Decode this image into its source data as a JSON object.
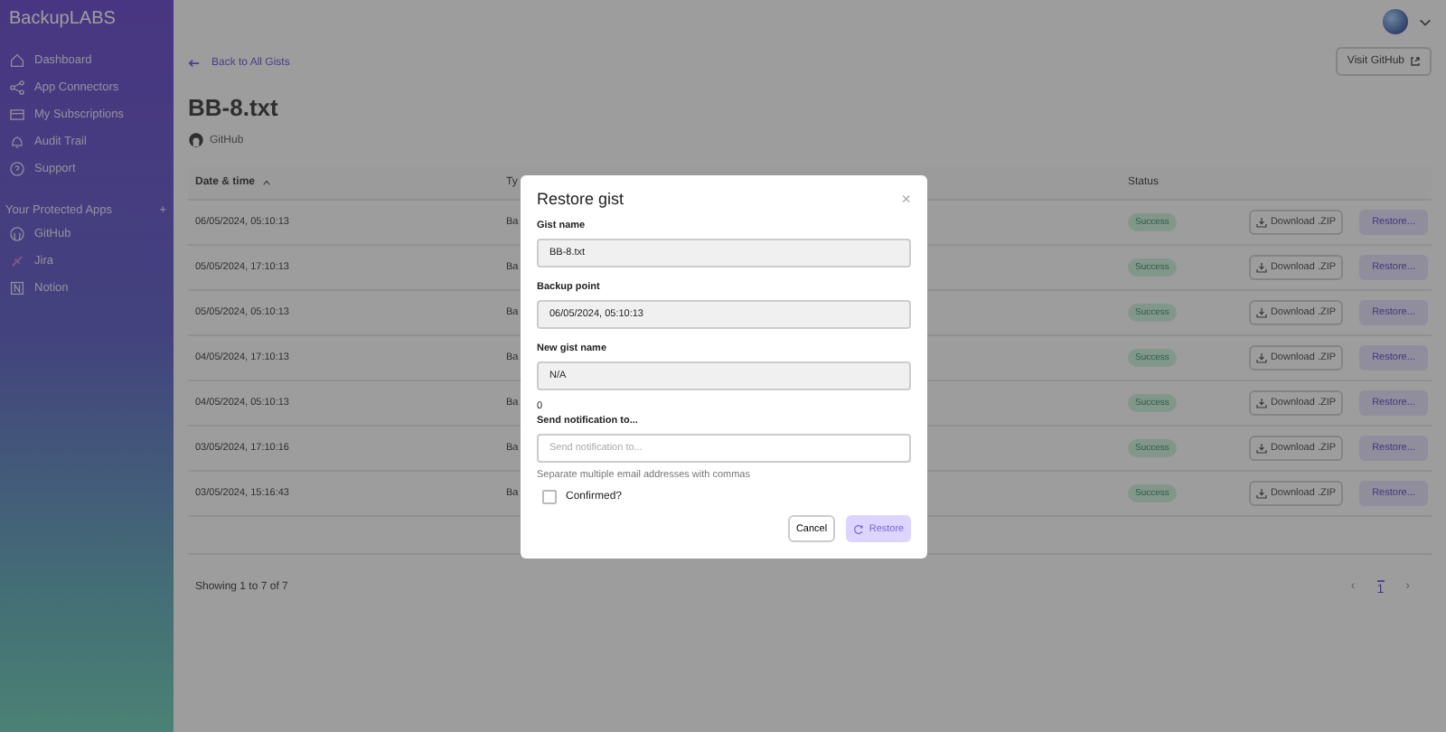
{
  "sidebar": {
    "brand": "BackupLABS",
    "items": [
      {
        "label": "Dashboard"
      },
      {
        "label": "App Connectors"
      },
      {
        "label": "My Subscriptions"
      },
      {
        "label": "Audit Trail"
      },
      {
        "label": "Support"
      }
    ],
    "section": {
      "title": "Your Protected Apps",
      "add": "+"
    },
    "apps": [
      {
        "label": "GitHub"
      },
      {
        "label": "Jira"
      },
      {
        "label": "Notion"
      }
    ]
  },
  "header": {
    "back_link": "Back to All Gists",
    "visit_button": "Visit GitHub",
    "title": "BB-8.txt",
    "source": "GitHub"
  },
  "table": {
    "columns": [
      {
        "label": "Date & time",
        "sorted": true
      },
      {
        "label": "Ty",
        "sorted": false
      },
      {
        "label": "Status",
        "sorted": false
      }
    ],
    "rows": [
      {
        "date": "06/05/2024, 05:10:13",
        "type": "Ba",
        "status": "Success",
        "download": "Download .ZIP",
        "restore": "Restore..."
      },
      {
        "date": "05/05/2024, 17:10:13",
        "type": "Ba",
        "status": "Success",
        "download": "Download .ZIP",
        "restore": "Restore..."
      },
      {
        "date": "05/05/2024, 05:10:13",
        "type": "Ba",
        "status": "Success",
        "download": "Download .ZIP",
        "restore": "Restore..."
      },
      {
        "date": "04/05/2024, 17:10:13",
        "type": "Ba",
        "status": "Success",
        "download": "Download .ZIP",
        "restore": "Restore..."
      },
      {
        "date": "04/05/2024, 05:10:13",
        "type": "Ba",
        "status": "Success",
        "download": "Download .ZIP",
        "restore": "Restore..."
      },
      {
        "date": "03/05/2024, 17:10:16",
        "type": "Ba",
        "status": "Success",
        "download": "Download .ZIP",
        "restore": "Restore..."
      },
      {
        "date": "03/05/2024, 15:16:43",
        "type": "Ba",
        "status": "Success",
        "download": "Download .ZIP",
        "restore": "Restore..."
      }
    ],
    "footer": "Showing 1 to 7 of 7",
    "pagination": {
      "prev": "‹",
      "pages": [
        {
          "label": "1",
          "selected": true
        }
      ],
      "next": "›"
    }
  },
  "dialog": {
    "title": "Restore gist",
    "close": "×",
    "fields": [
      {
        "label": "Gist name",
        "value": "BB-8.txt"
      },
      {
        "label": "Backup point",
        "value": "06/05/2024, 05:10:13"
      },
      {
        "label": "New gist name",
        "value": "N/A"
      }
    ],
    "counter": "0",
    "notify": {
      "label": "Send notification to...",
      "placeholder": "Send notification to...",
      "help": "Separate multiple email addresses with commas"
    },
    "confirm": {
      "label": "Confirmed?",
      "checked": false
    },
    "cancel": "Cancel",
    "restore": {
      "label": "Restore",
      "disabled": true
    }
  }
}
